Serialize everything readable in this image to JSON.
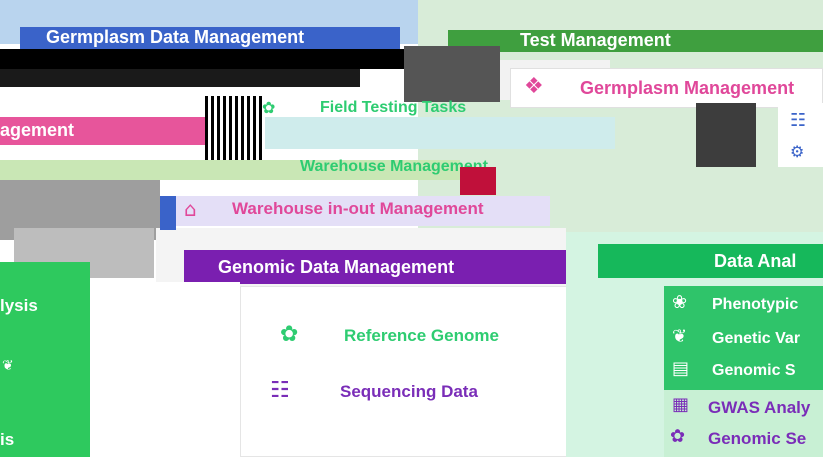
{
  "germplasm_panel": {
    "title": "Germplasm Data Management",
    "partial_label_1": "agement",
    "partial_label_2": "Germplasm Management"
  },
  "test_panel": {
    "title": "Test Management",
    "items": [
      {
        "label": "Field Testing Tasks",
        "icon": "plant-icon"
      },
      {
        "label": "Warehouse Management",
        "icon": "warehouse-icon"
      }
    ]
  },
  "germplasm_mgmt_card": {
    "label": "Germplasm Management",
    "icon": "germplasm-icon"
  },
  "warehouse_inout": {
    "label": "Warehouse in-out Management",
    "icon": "warehouse-icon"
  },
  "genomic_panel": {
    "title": "Genomic Data Management",
    "items": [
      {
        "label": "Reference Genome",
        "icon": "dna-icon"
      },
      {
        "label": "Sequencing Data",
        "icon": "sequencing-icon"
      }
    ]
  },
  "analysis_panel": {
    "title": "Data Anal",
    "items": [
      {
        "label": "Phenotypic",
        "icon": "seedling-icon"
      },
      {
        "label": "Genetic Var",
        "icon": "dna-icon"
      },
      {
        "label": "Genomic S",
        "icon": "chart-icon"
      },
      {
        "label": "GWAS Analy",
        "icon": "gwas-icon"
      },
      {
        "label": "Genomic Se",
        "icon": "genomic-select-icon"
      }
    ]
  },
  "left_fragments": {
    "analysis": "lysis",
    "item_a": "is",
    "item_b": "s"
  },
  "colors": {
    "germplasm_header": "#3a63c9",
    "test_header": "#2f9e57",
    "genomic_header": "#7a1fb0",
    "analysis_header": "#16b85b",
    "magenta": "#e0489a",
    "purple": "#7a2db8",
    "green_text": "#2ecc71"
  }
}
